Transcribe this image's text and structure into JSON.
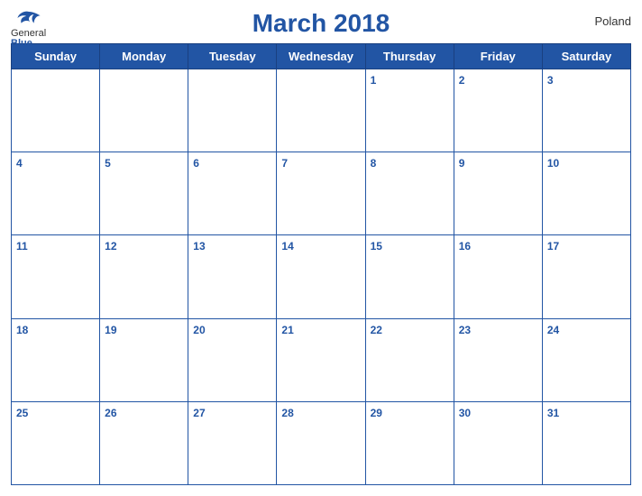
{
  "header": {
    "title": "March 2018",
    "country": "Poland",
    "logo_general": "General",
    "logo_blue": "Blue"
  },
  "days_of_week": [
    "Sunday",
    "Monday",
    "Tuesday",
    "Wednesday",
    "Thursday",
    "Friday",
    "Saturday"
  ],
  "weeks": [
    [
      null,
      null,
      null,
      null,
      1,
      2,
      3
    ],
    [
      4,
      5,
      6,
      7,
      8,
      9,
      10
    ],
    [
      11,
      12,
      13,
      14,
      15,
      16,
      17
    ],
    [
      18,
      19,
      20,
      21,
      22,
      23,
      24
    ],
    [
      25,
      26,
      27,
      28,
      29,
      30,
      31
    ]
  ]
}
